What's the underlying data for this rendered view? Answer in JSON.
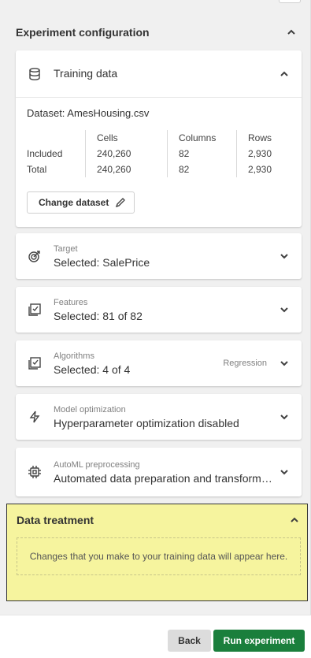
{
  "config": {
    "title": "Experiment configuration"
  },
  "training_data": {
    "label": "Training data",
    "dataset": "Dataset: AmesHousing.csv",
    "headers": [
      "Cells",
      "Columns",
      "Rows"
    ],
    "rows": [
      {
        "label": "Included",
        "cells": "240,260",
        "columns": "82",
        "rows": "2,930"
      },
      {
        "label": "Total",
        "cells": "240,260",
        "columns": "82",
        "rows": "2,930"
      }
    ],
    "change_label": "Change dataset"
  },
  "cards": {
    "target": {
      "small": "Target",
      "main": "Selected: SalePrice",
      "icon": "target-icon"
    },
    "features": {
      "small": "Features",
      "main": "Selected: 81 of 82",
      "icon": "checklist-icon"
    },
    "algorithms": {
      "small": "Algorithms",
      "main": "Selected: 4 of 4",
      "side": "Regression",
      "icon": "checklist-icon"
    },
    "optimization": {
      "small": "Model optimization",
      "main": "Hyperparameter optimization disabled",
      "icon": "lightning-icon"
    },
    "preprocessing": {
      "small": "AutoML preprocessing",
      "main": "Automated data preparation and transform…",
      "icon": "chip-icon"
    }
  },
  "data_treatment": {
    "title": "Data treatment",
    "empty": "Changes that you make to your training data will appear here."
  },
  "footer": {
    "back": "Back",
    "run": "Run experiment"
  },
  "colors": {
    "run_button": "#1a7f3c",
    "highlight": "#f6f49e"
  }
}
